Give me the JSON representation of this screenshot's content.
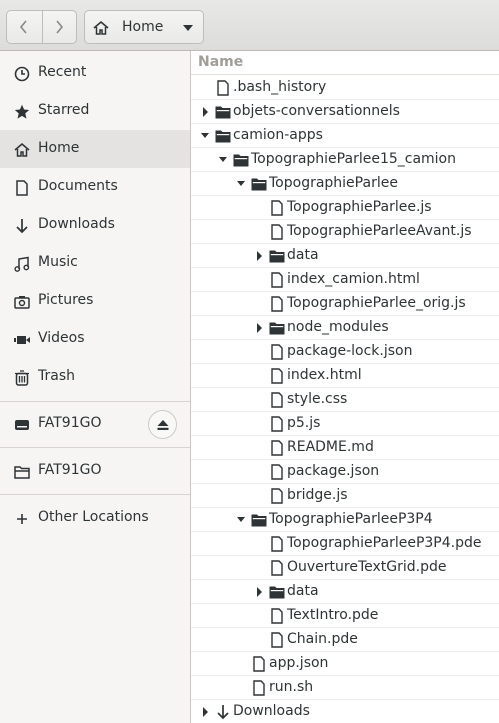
{
  "header": {
    "back_icon": "chevron-left-icon",
    "forward_icon": "chevron-right-icon",
    "path_label": "Home"
  },
  "sidebar": {
    "items": [
      {
        "label": "Recent",
        "icon": "clock-icon"
      },
      {
        "label": "Starred",
        "icon": "star-icon"
      },
      {
        "label": "Home",
        "icon": "home-icon"
      },
      {
        "label": "Documents",
        "icon": "document-icon"
      },
      {
        "label": "Downloads",
        "icon": "download-icon"
      },
      {
        "label": "Music",
        "icon": "music-icon"
      },
      {
        "label": "Pictures",
        "icon": "camera-icon"
      },
      {
        "label": "Videos",
        "icon": "video-icon"
      },
      {
        "label": "Trash",
        "icon": "trash-icon"
      }
    ],
    "drive": {
      "label": "FAT91GO",
      "icon": "drive-icon"
    },
    "mount": {
      "label": "FAT91GO",
      "icon": "folder-icon"
    },
    "other": {
      "label": "Other Locations",
      "icon": "plus-icon"
    }
  },
  "list": {
    "column_name": "Name",
    "rows": [
      {
        "name": ".bash_history",
        "type": "file",
        "depth": 0,
        "expander": "none"
      },
      {
        "name": "objets-conversationnels",
        "type": "folder",
        "depth": 0,
        "expander": "collapsed"
      },
      {
        "name": "camion-apps",
        "type": "folder",
        "depth": 0,
        "expander": "expanded"
      },
      {
        "name": "TopographieParlee15_camion",
        "type": "folder",
        "depth": 1,
        "expander": "expanded"
      },
      {
        "name": "TopographieParlee",
        "type": "folder",
        "depth": 2,
        "expander": "expanded"
      },
      {
        "name": "TopographieParlee.js",
        "type": "file",
        "depth": 3,
        "expander": "none"
      },
      {
        "name": "TopographieParleeAvant.js",
        "type": "file",
        "depth": 3,
        "expander": "none"
      },
      {
        "name": "data",
        "type": "folder",
        "depth": 3,
        "expander": "collapsed"
      },
      {
        "name": "index_camion.html",
        "type": "file",
        "depth": 3,
        "expander": "none"
      },
      {
        "name": "TopographieParlee_orig.js",
        "type": "file",
        "depth": 3,
        "expander": "none"
      },
      {
        "name": "node_modules",
        "type": "folder",
        "depth": 3,
        "expander": "collapsed"
      },
      {
        "name": "package-lock.json",
        "type": "file",
        "depth": 3,
        "expander": "none"
      },
      {
        "name": "index.html",
        "type": "file",
        "depth": 3,
        "expander": "none"
      },
      {
        "name": "style.css",
        "type": "file",
        "depth": 3,
        "expander": "none"
      },
      {
        "name": "p5.js",
        "type": "file",
        "depth": 3,
        "expander": "none"
      },
      {
        "name": "README.md",
        "type": "file",
        "depth": 3,
        "expander": "none"
      },
      {
        "name": "package.json",
        "type": "file",
        "depth": 3,
        "expander": "none"
      },
      {
        "name": "bridge.js",
        "type": "file",
        "depth": 3,
        "expander": "none"
      },
      {
        "name": "TopographieParleeP3P4",
        "type": "folder",
        "depth": 2,
        "expander": "expanded"
      },
      {
        "name": "TopographieParleeP3P4.pde",
        "type": "file",
        "depth": 3,
        "expander": "none"
      },
      {
        "name": "OuvertureTextGrid.pde",
        "type": "file",
        "depth": 3,
        "expander": "none"
      },
      {
        "name": "data",
        "type": "folder",
        "depth": 3,
        "expander": "collapsed"
      },
      {
        "name": "TextIntro.pde",
        "type": "file",
        "depth": 3,
        "expander": "none"
      },
      {
        "name": "Chain.pde",
        "type": "file",
        "depth": 3,
        "expander": "none"
      },
      {
        "name": "app.json",
        "type": "file",
        "depth": 2,
        "expander": "none"
      },
      {
        "name": "run.sh",
        "type": "file",
        "depth": 2,
        "expander": "none"
      },
      {
        "name": "Downloads",
        "type": "download-folder",
        "depth": 0,
        "expander": "collapsed"
      }
    ]
  }
}
